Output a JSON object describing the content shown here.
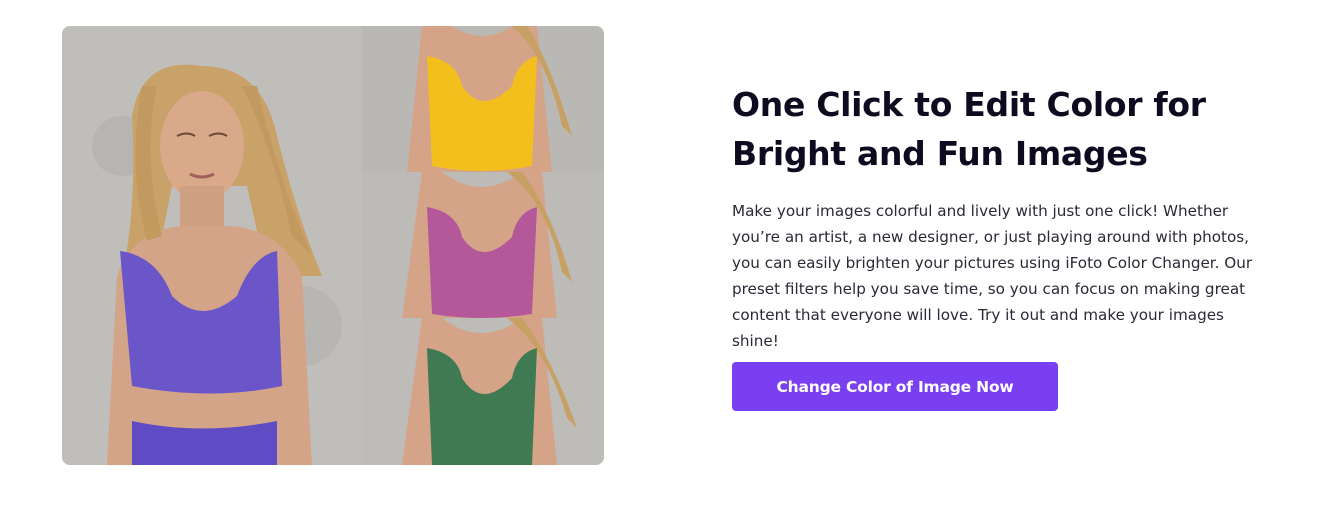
{
  "feature": {
    "heading": "One Click to Edit Color for Bright and Fun Images",
    "description": "Make your images colorful and lively with just one click! Whether you’re an artist, a new designer, or just playing around with photos, you can easily brighten your pictures using iFoto Color Changer. Our preset filters help you save time, so you can focus on making great content that everyone will love. Try it out and make your images shine!",
    "cta_label": "Change Color of Image Now"
  },
  "collage": {
    "main_top_color": "#6a55c9",
    "variants": [
      {
        "name": "yellow",
        "color": "#f2bf1c"
      },
      {
        "name": "pink",
        "color": "#b4589a"
      },
      {
        "name": "green",
        "color": "#3f7a52"
      }
    ]
  },
  "colors": {
    "accent": "#7b3ff2",
    "heading": "#0e0b20",
    "body": "#2b2935"
  }
}
